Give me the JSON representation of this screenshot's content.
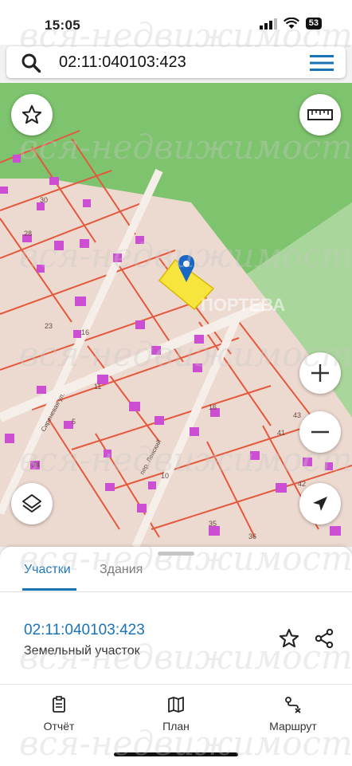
{
  "status": {
    "time": "15:05",
    "battery": "53"
  },
  "search": {
    "query": "02:11:040103:423"
  },
  "map": {
    "house_numbers": [
      "30",
      "28",
      "23",
      "16",
      "11",
      "5",
      "16",
      "43",
      "41",
      "10",
      "42",
      "35",
      "36",
      "34"
    ],
    "street_labels": [
      "Сиреневая ул.",
      "пер. Ленский"
    ],
    "brand": "ПОРТЕВА",
    "colors": {
      "parcel_fill": "#f0c9bb",
      "parcel_line": "#e4583c",
      "forest": "#7ec36d",
      "selected": "#f7e43c",
      "pin": "#1a66c4",
      "building": "#cc4ed2"
    }
  },
  "panel": {
    "tabs": [
      "Участки",
      "Здания"
    ],
    "parcel_id": "02:11:040103:423",
    "parcel_type": "Земельный участок"
  },
  "nav": {
    "report": "Отчёт",
    "plan": "План",
    "route": "Маршрут"
  },
  "watermark": "вся-недвижимость.net"
}
